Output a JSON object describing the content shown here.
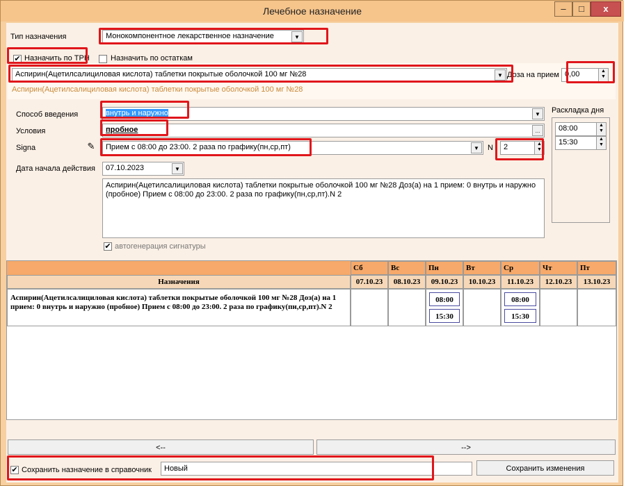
{
  "window": {
    "title": "Лечебное назначение",
    "minimize": "–",
    "maximize": "□",
    "close": "x"
  },
  "form": {
    "type_label": "Тип назначения",
    "type_value": "Монокомпонентное лекарственное назначение",
    "assign_trn_label": "Назначить по ТРН",
    "assign_stock_label": "Назначить по остаткам",
    "drug_value": "Аспирин(Ацетилсалициловая кислота) таблетки покрытые оболочкой 100 мг №28",
    "drug_hint": "Аспирин(Ацетилсалициловая кислота) таблетки покрытые оболочкой 100 мг №28",
    "dose_label": "Доза на прием",
    "dose_value": "0,00",
    "route_label": "Способ введения",
    "route_value": "внутрь и наружно",
    "conditions_label": "Условия",
    "conditions_value": "пробное",
    "signa_label": "Signa",
    "signa_value": "Прием с 08:00 до 23:00. 2 раза по графику(пн,ср,пт)",
    "n_label": "N",
    "n_value": "2",
    "start_label": "Дата начала действия",
    "start_value": "07.10.2023",
    "summary_text": "Аспирин(Ацетилсалициловая кислота) таблетки покрытые оболочкой 100 мг №28 Доз(а) на 1 прием: 0  внутрь и наружно (пробное)  Прием с 08:00 до 23:00. 2 раза по графику(пн,ср,пт).N 2",
    "autogen_label": "автогенерация сигнатуры",
    "layout_label": "Раскладка дня",
    "layout_times": [
      "08:00",
      "15:30"
    ]
  },
  "schedule": {
    "header_label": "Назначения",
    "days": [
      {
        "dow": "Сб",
        "date": "07.10.23",
        "times": []
      },
      {
        "dow": "Вс",
        "date": "08.10.23",
        "times": []
      },
      {
        "dow": "Пн",
        "date": "09.10.23",
        "times": [
          "08:00",
          "15:30"
        ]
      },
      {
        "dow": "Вт",
        "date": "10.10.23",
        "times": []
      },
      {
        "dow": "Ср",
        "date": "11.10.23",
        "times": [
          "08:00",
          "15:30"
        ]
      },
      {
        "dow": "Чт",
        "date": "12.10.23",
        "times": []
      },
      {
        "dow": "Пт",
        "date": "13.10.23",
        "times": []
      }
    ],
    "row_text": "Аспирин(Ацетилсалициловая кислота) таблетки покрытые оболочкой 100 мг №28 Доз(а) на 1 прием: 0  внутрь и наружно (пробное)  Прием с 08:00 до 23:00. 2 раза по графику(пн,ср,пт).N 2"
  },
  "footer": {
    "prev_label": "<--",
    "next_label": "-->",
    "save_ref_label": "Сохранить назначение в справочник",
    "name_value": "Новый",
    "save_btn": "Сохранить изменения"
  },
  "icons": {
    "checkbox_checked": "✔",
    "dropdown": "▼",
    "pencil": "pencil-icon",
    "ellipsis": "..."
  },
  "colors": {
    "window_bg": "#f7cfa0",
    "content_bg": "#fbf0e6",
    "grid_header": "#f6a96a",
    "annotation": "#e0161b",
    "selection": "#3399ff"
  }
}
